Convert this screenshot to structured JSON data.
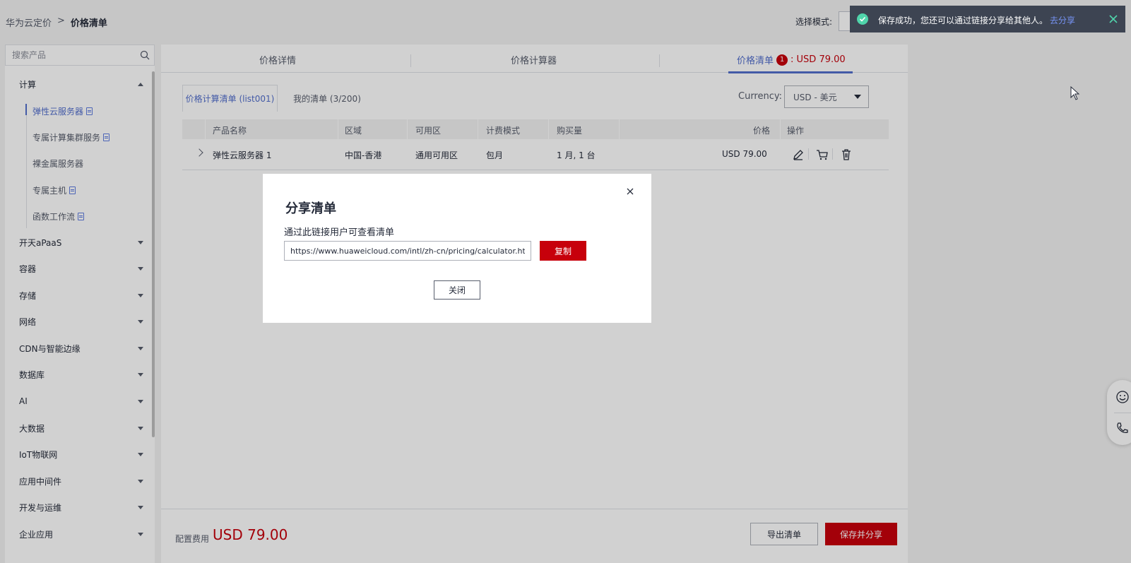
{
  "breadcrumb": {
    "root": "华为云定价",
    "sep": ">",
    "current": "价格清单"
  },
  "header": {
    "mode_label": "选择模式:"
  },
  "sidebar": {
    "search_placeholder": "搜索产品",
    "categories": [
      {
        "label": "计算",
        "expanded": true
      },
      {
        "label": "开天aPaaS"
      },
      {
        "label": "容器"
      },
      {
        "label": "存储"
      },
      {
        "label": "网络"
      },
      {
        "label": "CDN与智能边缘"
      },
      {
        "label": "数据库"
      },
      {
        "label": "AI"
      },
      {
        "label": "大数据"
      },
      {
        "label": "IoT物联网"
      },
      {
        "label": "应用中间件"
      },
      {
        "label": "开发与运维"
      },
      {
        "label": "企业应用"
      }
    ],
    "sub_items": [
      {
        "label": "弹性云服务器",
        "active": true
      },
      {
        "label": "专属计算集群服务"
      },
      {
        "label": "裸金属服务器"
      },
      {
        "label": "专属主机"
      },
      {
        "label": "函数工作流"
      }
    ]
  },
  "tabs": {
    "details": "价格详情",
    "calculator": "价格计算器",
    "list": "价格清单",
    "badge": "1",
    "price": ": USD 79.00"
  },
  "subtabs": {
    "active": "价格计算清单 (list001)",
    "mine": "我的清单 (3/200)"
  },
  "currency": {
    "label": "Currency:",
    "value": "USD - 美元"
  },
  "table": {
    "headers": [
      "产品名称",
      "区域",
      "可用区",
      "计费模式",
      "购买量",
      "价格",
      "操作"
    ],
    "rows": [
      {
        "name": "弹性云服务器 1",
        "region": "中国-香港",
        "zone": "通用可用区",
        "billing": "包月",
        "qty": "1 月, 1 台",
        "price": "USD 79.00"
      }
    ]
  },
  "footer": {
    "fee_label": "配置费用",
    "fee_value": "USD 79.00",
    "export": "导出清单",
    "save_share": "保存并分享"
  },
  "dialog": {
    "title": "分享清单",
    "description": "通过此链接用户可查看清单",
    "url": "https://www.huaweicloud.com/intl/zh-cn/pricing/calculator.html",
    "copy": "复制",
    "close": "关闭"
  },
  "toast": {
    "message": "保存成功，您还可以通过链接分享给其他人。",
    "link": "去分享"
  },
  "colors": {
    "brand_red": "#c7000b",
    "accent_blue": "#526ecc",
    "toast_bg": "#3d4452",
    "success_green": "#50d4ab"
  }
}
